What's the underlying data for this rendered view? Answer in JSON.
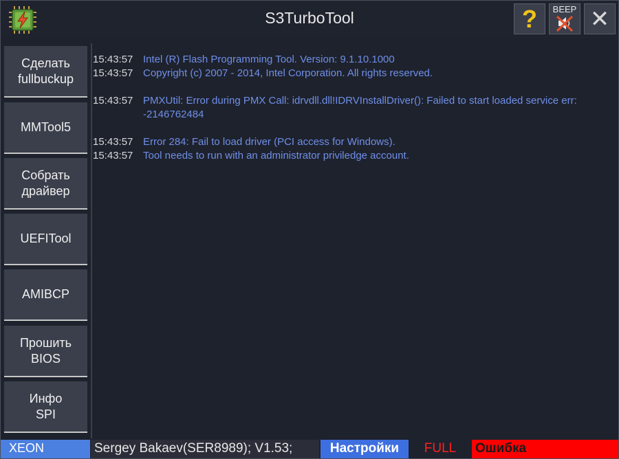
{
  "window": {
    "title": "S3TurboTool"
  },
  "titlebar": {
    "help_label": "?",
    "beep_label": "BEEP",
    "close_label": "✕",
    "colors": {
      "help": "#f0c419",
      "mute_cross": "#e2502a"
    }
  },
  "sidebar": {
    "items": [
      {
        "label": "Сделать\nfullbuckup"
      },
      {
        "label": "MMTool5"
      },
      {
        "label": "Собрать\nдрайвер"
      },
      {
        "label": "UEFITool"
      },
      {
        "label": "AMIBCP"
      },
      {
        "label": "Прошить\nBIOS"
      },
      {
        "label": "Инфо\nSPI"
      }
    ]
  },
  "log": {
    "lines": [
      {
        "time": "15:43:57",
        "text": "Intel (R) Flash Programming Tool. Version:  9.1.10.1000"
      },
      {
        "time": "15:43:57",
        "text": "Copyright (c) 2007 - 2014, Intel Corporation. All rights reserved."
      },
      {
        "time": "15:43:57",
        "text": "PMXUtil: Error during PMX Call: idrvdll.dll!IDRVInstallDriver(): Failed to start loaded service err: -2146762484"
      },
      {
        "time": "15:43:57",
        "text": "Error 284: Fail to load driver (PCI access for Windows)."
      },
      {
        "time": "15:43:57",
        "text": "Tool needs to run with an administrator priviledge account."
      }
    ]
  },
  "statusbar": {
    "cpu": "XEON",
    "author": "Sergey Bakaev(SER8989); V1.53;",
    "settings": "Настройки",
    "mode": "FULL",
    "state": "Ошибка",
    "colors": {
      "cpu_bg": "#4b7fe0",
      "settings_bg": "#3e6fe0",
      "mode_fg": "#ff2020",
      "state_bg": "#ff0000"
    }
  }
}
